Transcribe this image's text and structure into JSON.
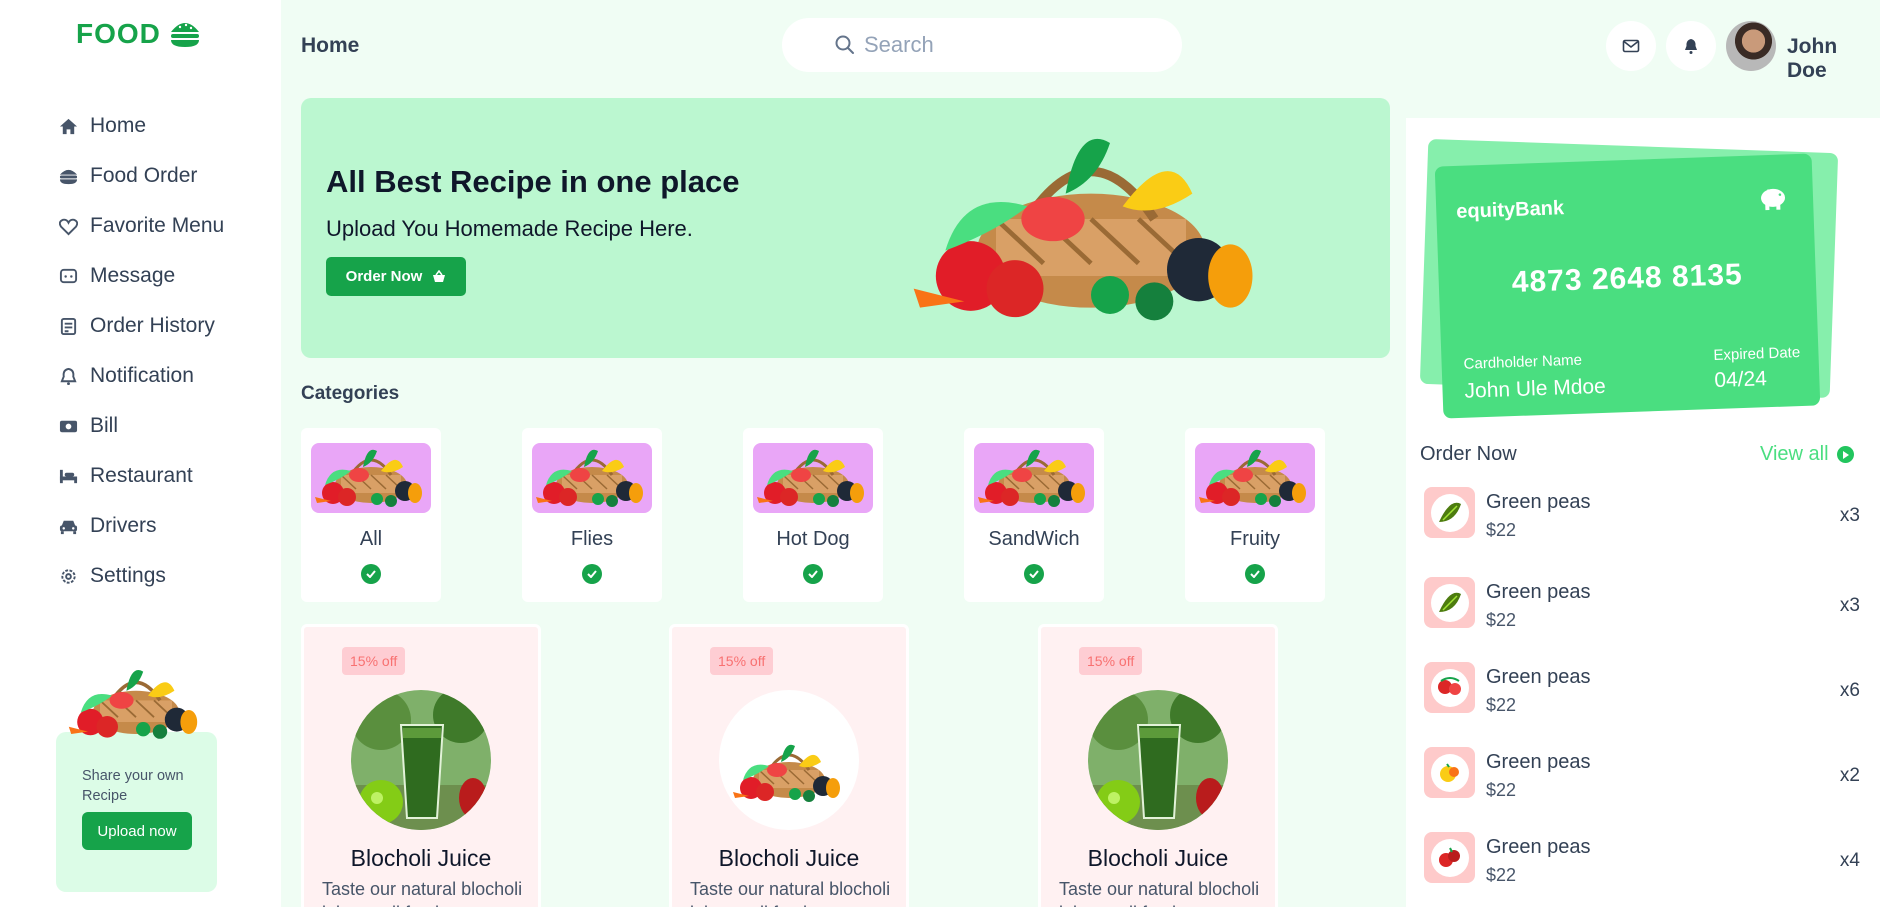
{
  "brand": {
    "name": "FOOD"
  },
  "sidebar": {
    "items": [
      {
        "label": "Home",
        "icon": "home-icon"
      },
      {
        "label": "Food Order",
        "icon": "burger-icon"
      },
      {
        "label": "Favorite Menu",
        "icon": "heart-icon"
      },
      {
        "label": "Message",
        "icon": "message-icon"
      },
      {
        "label": "Order History",
        "icon": "history-icon"
      },
      {
        "label": "Notification",
        "icon": "bell-icon"
      },
      {
        "label": "Bill",
        "icon": "bill-icon"
      },
      {
        "label": "Restaurant",
        "icon": "restaurant-icon"
      },
      {
        "label": "Drivers",
        "icon": "car-icon"
      },
      {
        "label": "Settings",
        "icon": "gear-icon"
      }
    ],
    "promo": {
      "text": "Share your own Recipe",
      "button": "Upload now"
    }
  },
  "header": {
    "breadcrumb": "Home",
    "search_placeholder": "Search",
    "user_name": "John Doe"
  },
  "banner": {
    "title": "All Best Recipe in one place",
    "subtitle": "Upload You Homemade Recipe Here.",
    "button": "Order Now"
  },
  "categories": {
    "title": "Categories",
    "items": [
      "All",
      "Flies",
      "Hot Dog",
      "SandWich",
      "Fruity"
    ]
  },
  "products": [
    {
      "badge": "15% off",
      "name": "Blocholi Juice",
      "desc": "Taste our natural blocholi juice, well fresh",
      "image": "green-juice"
    },
    {
      "badge": "15% off",
      "name": "Blocholi Juice",
      "desc": "Taste our natural blocholi juice, well fresh",
      "image": "vegetable-basket"
    },
    {
      "badge": "15% off",
      "name": "Blocholi Juice",
      "desc": "Taste our natural blocholi juice, well fresh",
      "image": "green-juice"
    }
  ],
  "card": {
    "bank": "equityBank",
    "number": "4873 2648 8135",
    "holder_label": "Cardholder Name",
    "holder_name": "John Ule Mdoe",
    "expiry_label": "Expired Date",
    "expiry": "04/24"
  },
  "orders": {
    "title": "Order Now",
    "view_all": "View all",
    "items": [
      {
        "name": "Green peas",
        "price": "$22",
        "qty": "x3"
      },
      {
        "name": "Green peas",
        "price": "$22",
        "qty": "x3"
      },
      {
        "name": "Green peas",
        "price": "$22",
        "qty": "x6"
      },
      {
        "name": "Green peas",
        "price": "$22",
        "qty": "x2"
      },
      {
        "name": "Green peas",
        "price": "$22",
        "qty": "x4"
      }
    ]
  },
  "colors": {
    "accent": "#16a34a",
    "light_green": "#bbf7d0",
    "card": "#4ade80",
    "category_thumb": "#e9a6f7",
    "product_bg": "#fff1f2"
  }
}
